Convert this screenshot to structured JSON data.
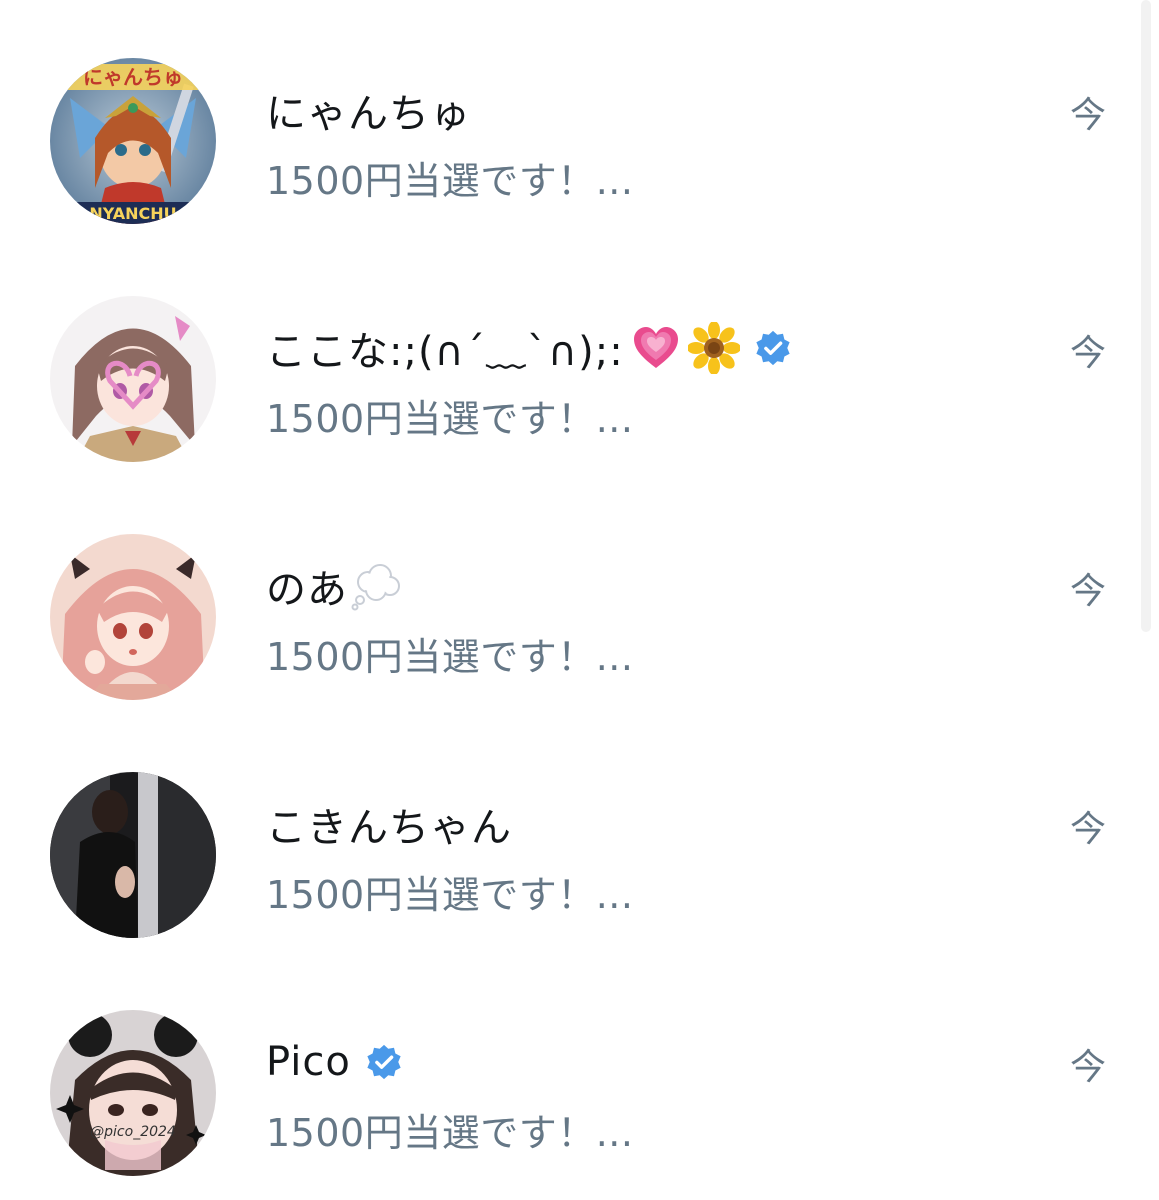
{
  "conversations": [
    {
      "name": "にゃんちゅ",
      "preview": "1500円当選です！...",
      "time": "今",
      "verified": false,
      "avatar_text": "にゃんちゅ",
      "avatar_bottom_text": "NYANCHU"
    },
    {
      "name": "ここな:;(∩´﹏`∩);:",
      "preview": "1500円当選です！...",
      "time": "今",
      "verified": true,
      "name_emojis": [
        "growing-heart-icon",
        "sunflower-icon"
      ]
    },
    {
      "name": "のあ",
      "preview": "1500円当選です！...",
      "time": "今",
      "verified": false,
      "name_emojis": [
        "thought-balloon-icon"
      ]
    },
    {
      "name": "こきんちゃん",
      "preview": "1500円当選です！...",
      "time": "今",
      "verified": false
    },
    {
      "name": "Pico",
      "preview": "1500円当選です！...",
      "time": "今",
      "verified": true,
      "avatar_text": "@pico_2024"
    }
  ],
  "colors": {
    "name_text": "#14171a",
    "secondary_text": "#657786",
    "verified_blue": "#4a99e9",
    "background": "#ffffff"
  }
}
